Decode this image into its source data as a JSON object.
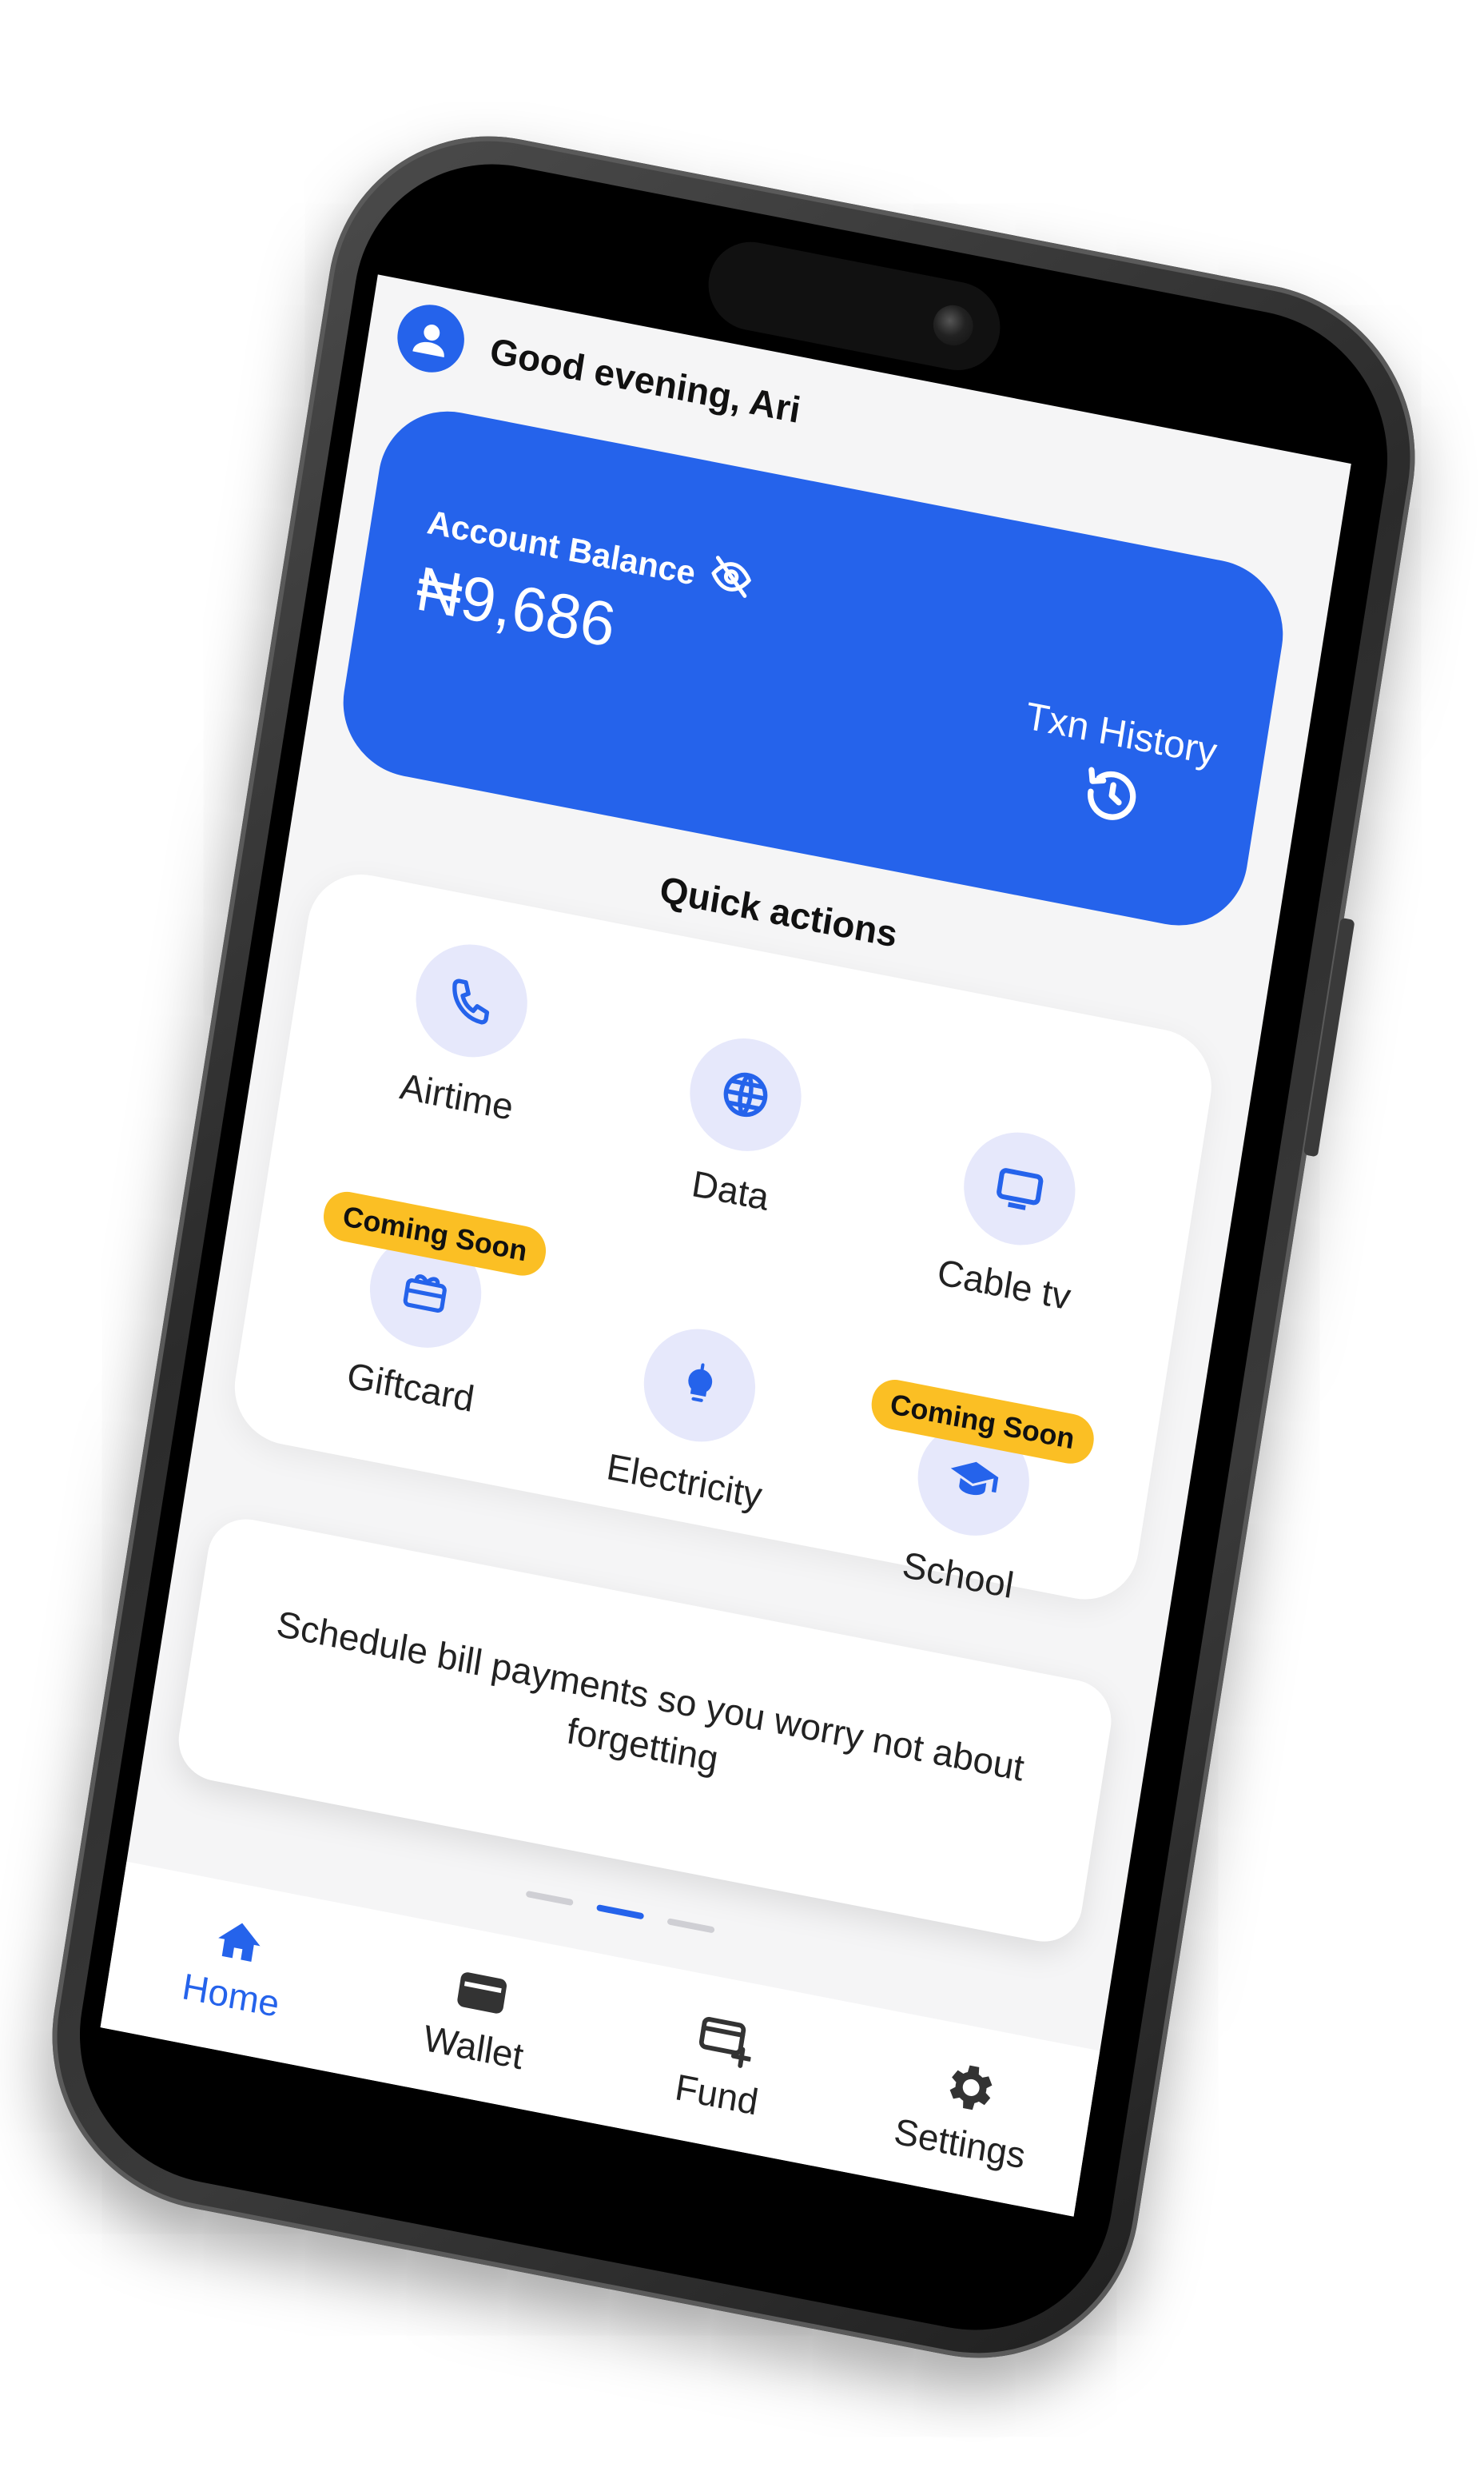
{
  "header": {
    "greeting": "Good evening, Ari"
  },
  "balance": {
    "label": "Account Balance",
    "amount": "₦9,686",
    "txn_history_label": "Txn History"
  },
  "quick_actions": {
    "title": "Quick actions",
    "items": [
      {
        "label": "Airtime",
        "icon": "phone-icon",
        "badge": ""
      },
      {
        "label": "Data",
        "icon": "globe-icon",
        "badge": ""
      },
      {
        "label": "Cable tv",
        "icon": "tv-icon",
        "badge": ""
      },
      {
        "label": "Giftcard",
        "icon": "gift-card-icon",
        "badge": "Coming Soon"
      },
      {
        "label": "Electricity",
        "icon": "bulb-icon",
        "badge": ""
      },
      {
        "label": "School",
        "icon": "graduation-cap-icon",
        "badge": "Coming Soon"
      }
    ]
  },
  "promo": {
    "text": "Schedule bill payments so you worry not about forgetting",
    "pages": 3,
    "active_page": 2
  },
  "nav": {
    "items": [
      {
        "label": "Home",
        "icon": "home-icon",
        "active": true
      },
      {
        "label": "Wallet",
        "icon": "wallet-icon",
        "active": false
      },
      {
        "label": "Fund",
        "icon": "fund-icon",
        "active": false
      },
      {
        "label": "Settings",
        "icon": "gear-icon",
        "active": false
      }
    ]
  },
  "colors": {
    "accent": "#2563eb",
    "badge": "#fbbf24",
    "icon_bg": "#e6e8fb",
    "screen_bg": "#f5f5f6"
  }
}
